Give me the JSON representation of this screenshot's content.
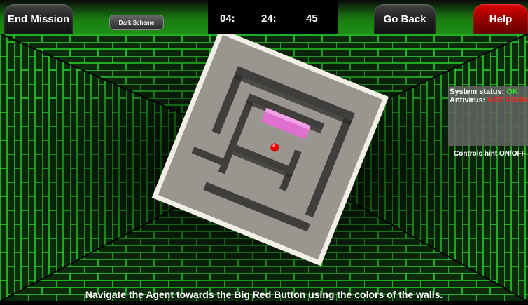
{
  "toolbar": {
    "end_label": "End Mission",
    "scheme_label": "Dark Scheme",
    "back_label": "Go Back",
    "help_label": "Help"
  },
  "timer": {
    "minutes": "04:",
    "seconds": "24:",
    "centis": "45"
  },
  "status": {
    "system_label": "System status:",
    "system_value": "OK",
    "antivirus_label": "Antivirus:",
    "antivirus_value": "NOT FOUND"
  },
  "controls_hint": "Controls hint ON/OFF",
  "instruction": "Navigate the Agent towards the Big Red Button using the colors of the walls.",
  "colors": {
    "grid": "#20c020",
    "wall_highlight": "#e070d0",
    "target": "#e00000",
    "ok": "#30e030",
    "warn": "#ff2020"
  }
}
